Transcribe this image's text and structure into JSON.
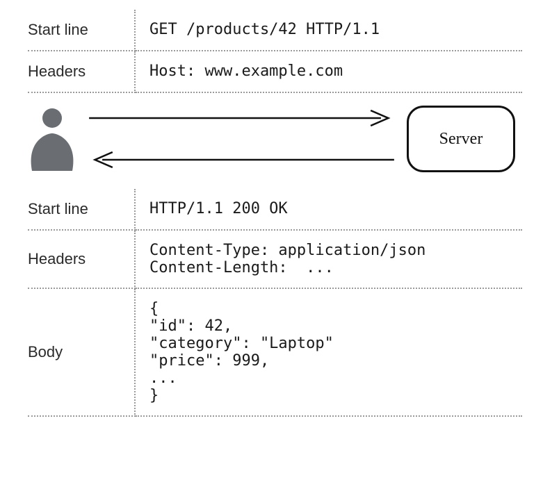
{
  "request": {
    "start_line_label": "Start line",
    "start_line_value": "GET /products/42 HTTP/1.1",
    "headers_label": "Headers",
    "headers_value": "Host: www.example.com"
  },
  "actors": {
    "server_label": "Server"
  },
  "response": {
    "start_line_label": "Start line",
    "start_line_value": "HTTP/1.1 200 OK",
    "headers_label": "Headers",
    "headers_value": "Content-Type: application/json\nContent-Length:  ...",
    "body_label": "Body",
    "body_value": "{\n\"id\": 42,\n\"category\": \"Laptop\"\n\"price\": 999,\n...\n}"
  }
}
